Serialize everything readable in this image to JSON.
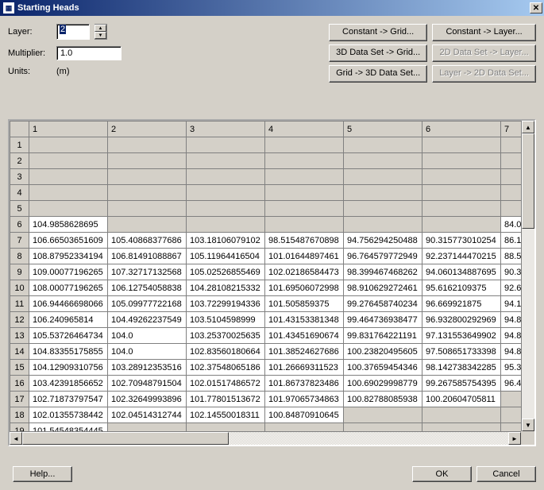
{
  "window": {
    "title": "Starting Heads"
  },
  "controls": {
    "layer_label": "Layer:",
    "layer_value": "2",
    "multiplier_label": "Multiplier:",
    "multiplier_value": "1.0",
    "units_label": "Units:",
    "units_value": "(m)"
  },
  "buttons": {
    "constant_to_grid": "Constant -> Grid...",
    "constant_to_layer": "Constant -> Layer...",
    "data3d_to_grid": "3D Data Set -> Grid...",
    "data2d_to_layer": "2D Data Set -> Layer...",
    "grid_to_3ddata": "Grid -> 3D Data Set...",
    "layer_to_2ddata": "Layer -> 2D Data Set...",
    "help": "Help...",
    "ok": "OK",
    "cancel": "Cancel"
  },
  "grid": {
    "col_headers": [
      "1",
      "2",
      "3",
      "4",
      "5",
      "6",
      "7"
    ],
    "row_headers": [
      "1",
      "2",
      "3",
      "4",
      "5",
      "6",
      "7",
      "8",
      "9",
      "10",
      "11",
      "12",
      "13",
      "14",
      "15",
      "16",
      "17",
      "18",
      "19"
    ],
    "rows": [
      {
        "r": 6,
        "cells": {
          "1": "104.9858628695",
          "7": "84.0"
        }
      },
      {
        "r": 7,
        "cells": {
          "1": "106.66503651609",
          "2": "105.40868377686",
          "3": "103.18106079102",
          "4": "98.515487670898",
          "5": "94.756294250488",
          "6": "90.315773010254",
          "7": "86.1"
        }
      },
      {
        "r": 8,
        "cells": {
          "1": "108.87952334194",
          "2": "106.81491088867",
          "3": "105.11964416504",
          "4": "101.01644897461",
          "5": "96.764579772949",
          "6": "92.237144470215",
          "7": "88.5"
        }
      },
      {
        "r": 9,
        "cells": {
          "1": "109.00077196265",
          "2": "107.32717132568",
          "3": "105.02526855469",
          "4": "102.02186584473",
          "5": "98.399467468262",
          "6": "94.060134887695",
          "7": "90.3"
        }
      },
      {
        "r": 10,
        "cells": {
          "1": "108.00077196265",
          "2": "106.12754058838",
          "3": "104.28108215332",
          "4": "101.69506072998",
          "5": "98.910629272461",
          "6": "95.6162109375",
          "7": "92.6"
        }
      },
      {
        "r": 11,
        "cells": {
          "1": "106.94466698066",
          "2": "105.09977722168",
          "3": "103.72299194336",
          "4": "101.505859375",
          "5": "99.276458740234",
          "6": "96.669921875",
          "7": "94.1"
        }
      },
      {
        "r": 12,
        "cells": {
          "1": "106.240965814",
          "2": "104.49262237549",
          "3": "103.5104598999",
          "4": "101.43153381348",
          "5": "99.464736938477",
          "6": "96.932800292969",
          "7": "94.8"
        }
      },
      {
        "r": 13,
        "cells": {
          "1": "105.53726464734",
          "2": "104.0",
          "3": "103.25370025635",
          "4": "101.43451690674",
          "5": "99.831764221191",
          "6": "97.131553649902",
          "7": "94.8"
        }
      },
      {
        "r": 14,
        "cells": {
          "1": "104.83355175855",
          "2": "104.0",
          "3": "102.83560180664",
          "4": "101.38524627686",
          "5": "100.23820495605",
          "6": "97.508651733398",
          "7": "94.8"
        }
      },
      {
        "r": 15,
        "cells": {
          "1": "104.12909310756",
          "2": "103.28912353516",
          "3": "102.37548065186",
          "4": "101.26669311523",
          "5": "100.37659454346",
          "6": "98.142738342285",
          "7": "95.3"
        }
      },
      {
        "r": 16,
        "cells": {
          "1": "103.42391856652",
          "2": "102.70948791504",
          "3": "102.01517486572",
          "4": "101.86737823486",
          "5": "100.69029998779",
          "6": "99.267585754395",
          "7": "96.4"
        }
      },
      {
        "r": 17,
        "cells": {
          "1": "102.71873797547",
          "2": "102.32649993896",
          "3": "101.77801513672",
          "4": "101.97065734863",
          "5": "100.82788085938",
          "6": "100.20604705811"
        }
      },
      {
        "r": 18,
        "cells": {
          "1": "102.01355738442",
          "2": "102.04514312744",
          "3": "102.14550018311",
          "4": "100.84870910645"
        }
      },
      {
        "r": 19,
        "cells": {
          "1": "101.54548354445"
        }
      }
    ]
  }
}
